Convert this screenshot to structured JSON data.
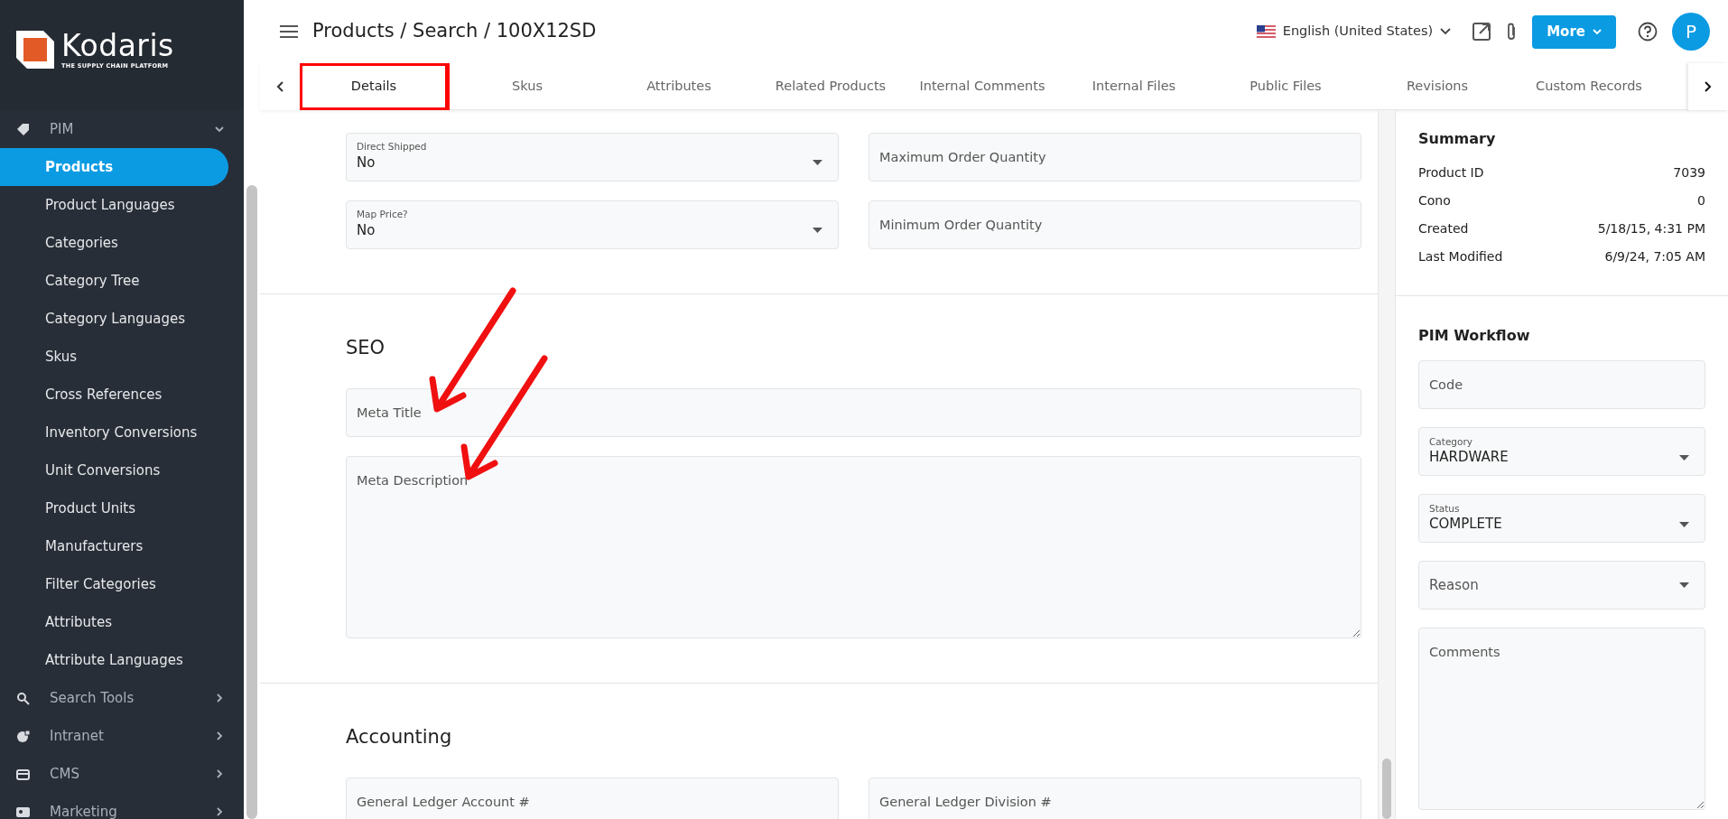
{
  "logo": {
    "name": "Kodaris",
    "tagline": "THE SUPPLY CHAIN PLATFORM"
  },
  "sidebar": {
    "groups": [
      {
        "label": "PIM",
        "expanded": true,
        "children": [
          {
            "label": "Products",
            "selected": true
          },
          {
            "label": "Product Languages",
            "selected": false
          },
          {
            "label": "Categories",
            "selected": false
          },
          {
            "label": "Category Tree",
            "selected": false
          },
          {
            "label": "Category Languages",
            "selected": false
          },
          {
            "label": "Skus",
            "selected": false
          },
          {
            "label": "Cross References",
            "selected": false
          },
          {
            "label": "Inventory Conversions",
            "selected": false
          },
          {
            "label": "Unit Conversions",
            "selected": false
          },
          {
            "label": "Product Units",
            "selected": false
          },
          {
            "label": "Manufacturers",
            "selected": false
          },
          {
            "label": "Filter Categories",
            "selected": false
          },
          {
            "label": "Attributes",
            "selected": false
          },
          {
            "label": "Attribute Languages",
            "selected": false
          }
        ]
      },
      {
        "label": "Search Tools",
        "expanded": false
      },
      {
        "label": "Intranet",
        "expanded": false
      },
      {
        "label": "CMS",
        "expanded": false
      },
      {
        "label": "Marketing",
        "expanded": false
      }
    ]
  },
  "header": {
    "title": "Products / Search / 100X12SD",
    "language": "English (United States)",
    "more_button": "More",
    "avatar": "P"
  },
  "tabs": [
    {
      "label": "Details",
      "selected": true,
      "highlighted": true
    },
    {
      "label": "Skus",
      "selected": false,
      "highlighted": false
    },
    {
      "label": "Attributes",
      "selected": false,
      "highlighted": false
    },
    {
      "label": "Related Products",
      "selected": false,
      "highlighted": false
    },
    {
      "label": "Internal Comments",
      "selected": false,
      "highlighted": false
    },
    {
      "label": "Internal Files",
      "selected": false,
      "highlighted": false
    },
    {
      "label": "Public Files",
      "selected": false,
      "highlighted": false
    },
    {
      "label": "Revisions",
      "selected": false,
      "highlighted": false
    },
    {
      "label": "Custom Records",
      "selected": false,
      "highlighted": false
    }
  ],
  "sections": [
    {
      "rows": [
        [
          {
            "kind": "select",
            "label": "Direct Shipped",
            "value": "No"
          },
          {
            "kind": "input",
            "placeholder": "Maximum Order Quantity"
          }
        ],
        [
          {
            "kind": "select",
            "label": "Map Price?",
            "value": "No"
          },
          {
            "kind": "input",
            "placeholder": "Minimum Order Quantity"
          }
        ]
      ]
    },
    {
      "title": "SEO",
      "rows": [
        [
          {
            "kind": "input",
            "placeholder": "Meta Title",
            "pointed": true
          }
        ],
        [
          {
            "kind": "textarea",
            "placeholder": "Meta Description",
            "pointed": true
          }
        ]
      ]
    },
    {
      "title": "Accounting",
      "rows": [
        [
          {
            "kind": "input",
            "placeholder": "General Ledger Account #"
          },
          {
            "kind": "input",
            "placeholder": "General Ledger Division #"
          }
        ]
      ]
    }
  ],
  "summary": {
    "title": "Summary",
    "rows": [
      {
        "label": "Product ID",
        "value": "7039"
      },
      {
        "label": "Cono",
        "value": "0"
      },
      {
        "label": "Created",
        "value": "5/18/15, 4:31 PM"
      },
      {
        "label": "Last Modified",
        "value": "6/9/24, 7:05 AM"
      }
    ]
  },
  "workflow": {
    "title": "PIM Workflow",
    "fields": [
      {
        "kind": "input",
        "placeholder": "Code"
      },
      {
        "kind": "select",
        "label": "Category",
        "value": "HARDWARE"
      },
      {
        "kind": "select",
        "label": "Status",
        "value": "COMPLETE"
      },
      {
        "kind": "select",
        "placeholder": "Reason"
      },
      {
        "kind": "textarea",
        "placeholder": "Comments"
      }
    ]
  }
}
